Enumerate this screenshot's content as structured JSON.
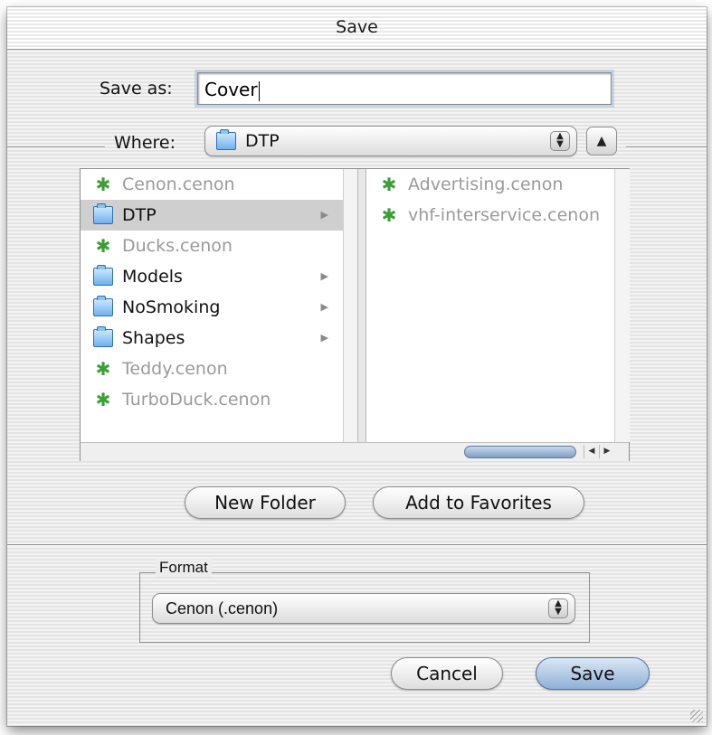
{
  "window": {
    "title": "Save"
  },
  "save_as": {
    "label": "Save as:",
    "value": "Cover"
  },
  "where": {
    "label": "Where:",
    "selected": "DTP",
    "selected_icon": "folder-icon"
  },
  "browser": {
    "column1": [
      {
        "name": "Cenon.cenon",
        "icon": "cenon-document-icon",
        "enabled": false,
        "folder": false
      },
      {
        "name": "DTP",
        "icon": "folder-icon",
        "enabled": true,
        "folder": true,
        "selected": true
      },
      {
        "name": "Ducks.cenon",
        "icon": "cenon-document-icon",
        "enabled": false,
        "folder": false
      },
      {
        "name": "Models",
        "icon": "folder-icon",
        "enabled": true,
        "folder": true
      },
      {
        "name": "NoSmoking",
        "icon": "folder-icon",
        "enabled": true,
        "folder": true
      },
      {
        "name": "Shapes",
        "icon": "folder-icon",
        "enabled": true,
        "folder": true
      },
      {
        "name": "Teddy.cenon",
        "icon": "cenon-document-icon",
        "enabled": false,
        "folder": false
      },
      {
        "name": "TurboDuck.cenon",
        "icon": "cenon-document-icon",
        "enabled": false,
        "folder": false
      }
    ],
    "column2": [
      {
        "name": "Advertising.cenon",
        "icon": "cenon-document-icon",
        "enabled": false
      },
      {
        "name": "vhf-interservice.cenon",
        "icon": "cenon-document-icon",
        "enabled": false
      }
    ]
  },
  "buttons": {
    "new_folder": "New Folder",
    "add_to_favorites": "Add to Favorites",
    "cancel": "Cancel",
    "save": "Save"
  },
  "format": {
    "group_label": "Format",
    "selected": "Cenon (.cenon)"
  },
  "colors": {
    "accent": "#8fb0d6",
    "cenon_icon": "#3aa035",
    "folder_icon": "#6fb0ee"
  }
}
